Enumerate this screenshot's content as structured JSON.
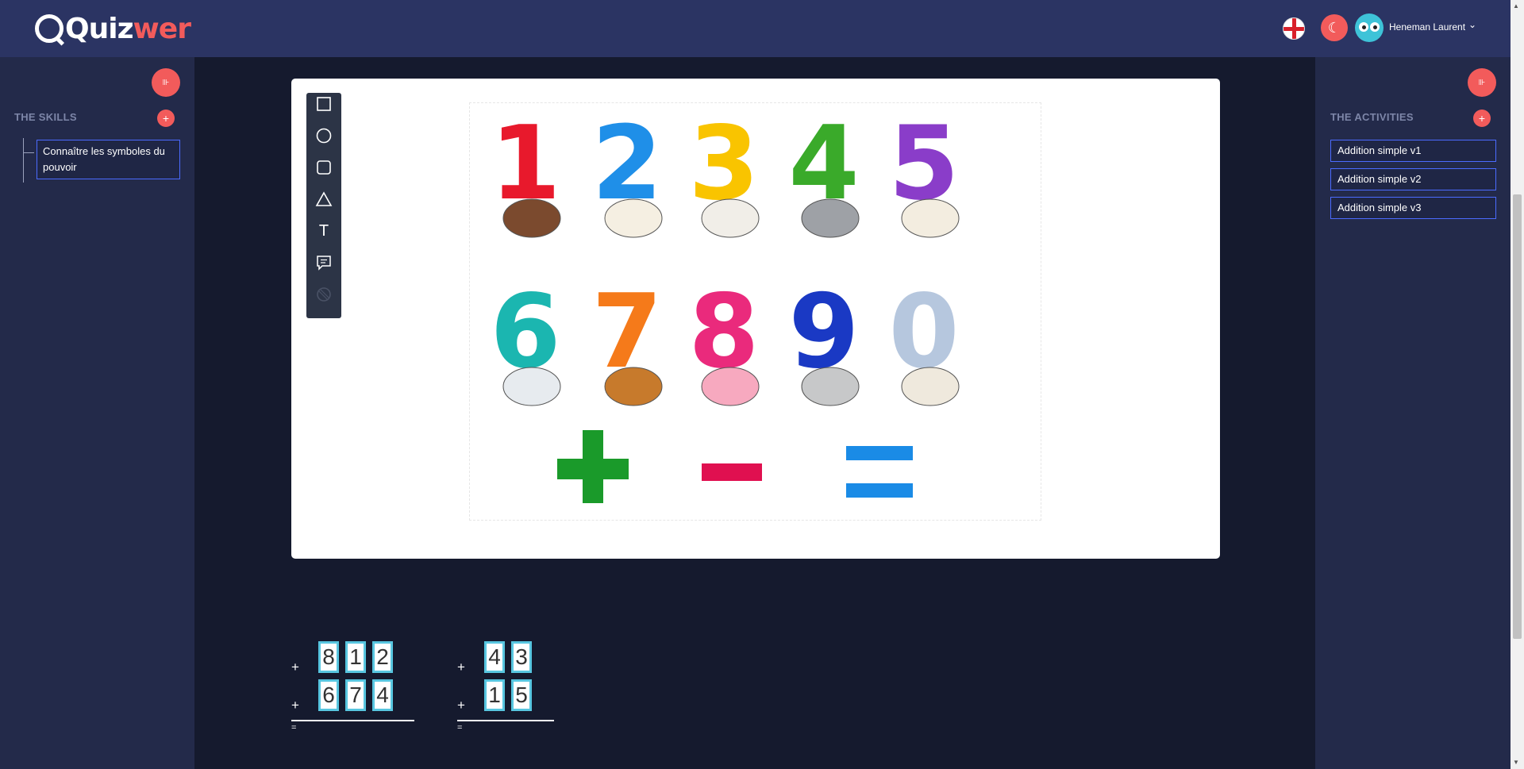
{
  "header": {
    "logo_main": "Quiz",
    "logo_accent": "wer",
    "user_name": "Heneman Laurent",
    "chevron": "⌄",
    "dark_mode_glyph": "☾"
  },
  "skills_panel": {
    "title": "THE SKILLS",
    "collapse_glyph": "⊪",
    "add_glyph": "+",
    "items": [
      {
        "label": "Connaître les symboles du pouvoir"
      }
    ]
  },
  "activities_panel": {
    "title": "THE ACTIVITIES",
    "collapse_glyph": "⊪",
    "add_glyph": "+",
    "items": [
      {
        "label": "Addition simple v1"
      },
      {
        "label": "Addition simple v2"
      },
      {
        "label": "Addition simple v3"
      }
    ]
  },
  "toolbar": {
    "tools": [
      "rectangle-tool",
      "circle-tool",
      "rounded-rect-tool",
      "triangle-tool",
      "text-tool",
      "comment-tool",
      "pattern-tool"
    ],
    "text_tool_glyph": "T"
  },
  "picture": {
    "numbers": [
      "1",
      "2",
      "3",
      "4",
      "5",
      "6",
      "7",
      "8",
      "9",
      "0"
    ],
    "number_colors": [
      "#e8192c",
      "#1f8fe8",
      "#f9c400",
      "#3aaa2a",
      "#8a3dc9",
      "#1bb6b0",
      "#f57a1a",
      "#ea2a7c",
      "#1a39c4",
      "#b6c7de"
    ],
    "symbols": [
      "+",
      "−",
      "="
    ],
    "symbol_colors": [
      "#1a9a2a",
      "#e01050",
      "#1a8be6"
    ]
  },
  "additions": [
    {
      "row1": [
        "8",
        "1",
        "2"
      ],
      "row2": [
        "6",
        "7",
        "4"
      ],
      "plus": "+",
      "equals": "="
    },
    {
      "row1": [
        "4",
        "3"
      ],
      "row2": [
        "1",
        "5"
      ],
      "plus": "+",
      "equals": "="
    }
  ]
}
